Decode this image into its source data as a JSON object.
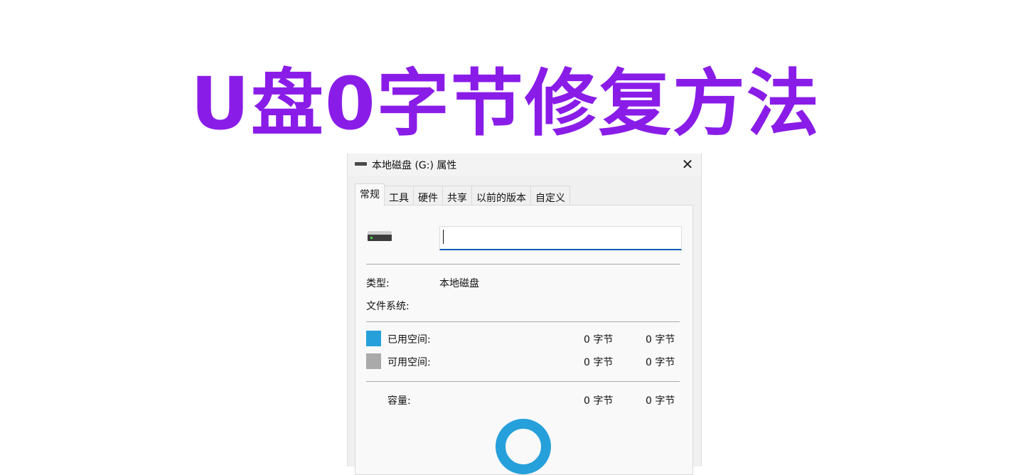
{
  "headline": {
    "text": "U盘0字节修复方法",
    "color": "#8a1ce8"
  },
  "window": {
    "title": "本地磁盘 (G:) 属性",
    "close_glyph": "✕",
    "title_icon": "drive-icon"
  },
  "tabs": [
    {
      "label": "常规",
      "active": true
    },
    {
      "label": "工具",
      "active": false
    },
    {
      "label": "硬件",
      "active": false
    },
    {
      "label": "共享",
      "active": false
    },
    {
      "label": "以前的版本",
      "active": false
    },
    {
      "label": "自定义",
      "active": false
    }
  ],
  "general": {
    "drive_name_value": "",
    "type_label": "类型:",
    "type_value": "本地磁盘",
    "filesystem_label": "文件系统:",
    "filesystem_value": "",
    "used": {
      "label": "已用空间:",
      "bytes": "0 字节",
      "size": "0 字节",
      "color": "#26a0da"
    },
    "free": {
      "label": "可用空间:",
      "bytes": "0 字节",
      "size": "0 字节",
      "color": "#aaaaaa"
    },
    "capacity": {
      "label": "容量:",
      "bytes": "0 字节",
      "size": "0 字节"
    }
  },
  "usage_chart": {
    "used_fraction": 0,
    "ring_color": "#26a0da"
  }
}
